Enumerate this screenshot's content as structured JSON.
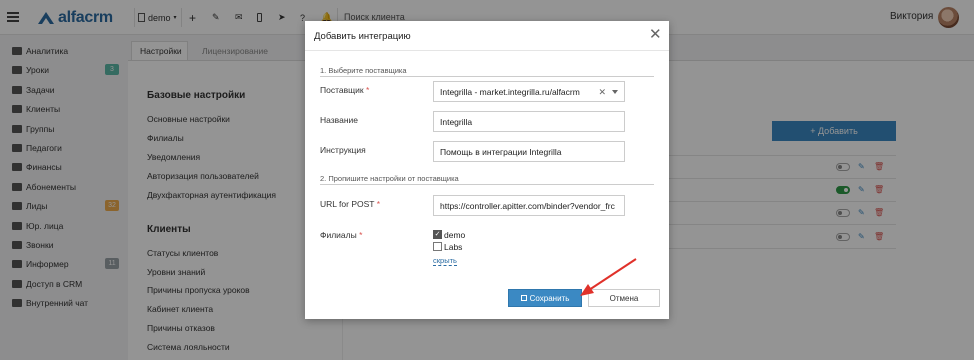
{
  "colors": {
    "accent": "#3b89c3",
    "danger": "#d9534f",
    "toggle_on": "#2f9a48",
    "overlay": "rgba(0,0,0,0.42)",
    "arrow": "#e0312a"
  },
  "topbar": {
    "logo_text": "alfacrm",
    "branch": "demo",
    "search_placeholder": "Поиск клиента",
    "user_name": "Виктория",
    "icons": [
      "menu-icon",
      "building-icon",
      "plus-icon",
      "wrench-icon",
      "mail-icon",
      "phone-icon",
      "telegram-icon",
      "question-icon",
      "bell-icon"
    ]
  },
  "sidebar": {
    "items": [
      {
        "label": "Аналитика",
        "icon": "chart-icon"
      },
      {
        "label": "Уроки",
        "icon": "calendar-icon",
        "badge": "3",
        "badge_color": "#5cb8a8"
      },
      {
        "label": "Задачи",
        "icon": "tasks-icon"
      },
      {
        "label": "Клиенты",
        "icon": "user-icon"
      },
      {
        "label": "Группы",
        "icon": "users-icon"
      },
      {
        "label": "Педагоги",
        "icon": "teacher-icon"
      },
      {
        "label": "Финансы",
        "icon": "money-icon"
      },
      {
        "label": "Абонементы",
        "icon": "tag-icon"
      },
      {
        "label": "Лиды",
        "icon": "funnel-icon",
        "badge": "32",
        "badge_color": "#f0ad4e"
      },
      {
        "label": "Юр. лица",
        "icon": "briefcase-icon"
      },
      {
        "label": "Звонки",
        "icon": "phone-icon"
      },
      {
        "label": "Информер",
        "icon": "globe-icon",
        "badge": "11",
        "badge_color": "#9aa3a8"
      },
      {
        "label": "Доступ в CRM",
        "icon": "lock-icon"
      },
      {
        "label": "Внутренний чат",
        "icon": "chat-icon"
      }
    ]
  },
  "tabs": [
    {
      "label": "Настройки"
    },
    {
      "label": "Лицензирование"
    }
  ],
  "settings_menu": {
    "base_title": "Базовые настройки",
    "base_items": [
      "Основные настройки",
      "Филиалы",
      "Уведомления",
      "Авторизация пользователей",
      "Двухфакторная аутентификация"
    ],
    "clients_title": "Клиенты",
    "client_items": [
      "Статусы клиентов",
      "Уровни знаний",
      "Причины пропуска уроков",
      "Кабинет клиента",
      "Причины отказов",
      "Система лояльности"
    ]
  },
  "main": {
    "add_button": "+ Добавить",
    "rows": [
      {
        "enabled": false
      },
      {
        "enabled": true
      },
      {
        "enabled": false
      },
      {
        "enabled": false
      }
    ]
  },
  "modal": {
    "title": "Добавить интеграцию",
    "step1": "1. Выберите поставщика",
    "provider_label": "Поставщик",
    "provider_value": "Integrilla - market.integrilla.ru/alfacrm",
    "name_label": "Название",
    "name_value": "Integrilla",
    "instruction_label": "Инструкция",
    "instruction_value": "Помощь в интеграции Integrilla",
    "step2": "2. Пропишите настройки от поставщика",
    "url_label": "URL for POST",
    "url_value": "https://controller.apitter.com/binder?vendor_frc",
    "branches_label": "Филиалы",
    "branches": [
      {
        "label": "demo",
        "checked": true
      },
      {
        "label": "Labs",
        "checked": false
      }
    ],
    "hide_link": "скрыть",
    "save_button": "Сохранить",
    "cancel_button": "Отмена"
  }
}
